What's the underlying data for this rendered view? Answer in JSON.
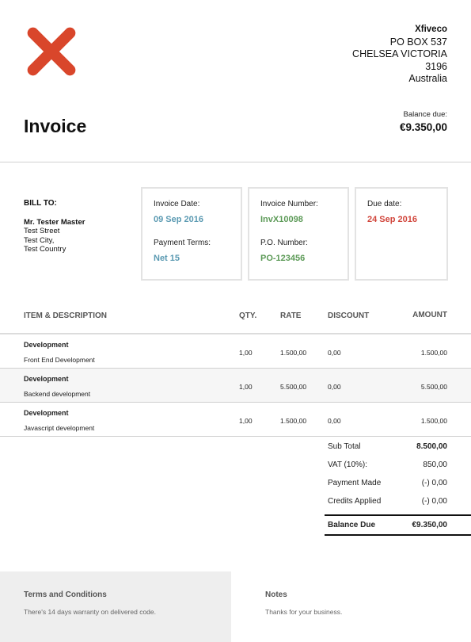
{
  "brand": {
    "logo_color": "#d9462b"
  },
  "company": {
    "name": "Xfiveco",
    "address_lines": [
      "PO BOX 537",
      "CHELSEA VICTORIA",
      "3196",
      "Australia"
    ]
  },
  "document": {
    "title": "Invoice",
    "balance_due_label": "Balance due:",
    "balance_due_amount": "€9.350,00"
  },
  "bill_to": {
    "label": "BILL TO:",
    "name": "Mr. Tester Master",
    "street": "Test Street",
    "city": "Test City,",
    "country": "Test Country"
  },
  "details": {
    "invoice_date_label": "Invoice Date:",
    "invoice_date": "09 Sep 2016",
    "payment_terms_label": "Payment Terms:",
    "payment_terms": "Net 15",
    "invoice_number_label": "Invoice Number:",
    "invoice_number": "InvX10098",
    "po_number_label": "P.O. Number:",
    "po_number": "PO-123456",
    "due_date_label": "Due date:",
    "due_date": "24 Sep 2016"
  },
  "table": {
    "headers": {
      "item": "ITEM & DESCRIPTION",
      "qty": "QTY.",
      "rate": "RATE",
      "discount": "DISCOUNT",
      "amount": "AMOUNT"
    },
    "rows": [
      {
        "item": "Development",
        "description": "Front End Development",
        "qty": "1,00",
        "rate": "1.500,00",
        "discount": "0,00",
        "amount": "1.500,00"
      },
      {
        "item": "Development",
        "description": "Backend development",
        "qty": "1,00",
        "rate": "5.500,00",
        "discount": "0,00",
        "amount": "5.500,00"
      },
      {
        "item": "Development",
        "description": "Javascript development",
        "qty": "1,00",
        "rate": "1.500,00",
        "discount": "0,00",
        "amount": "1.500,00"
      }
    ]
  },
  "totals": {
    "subtotal_label": "Sub Total",
    "subtotal": "8.500,00",
    "vat_label": "VAT (10%):",
    "vat": "850,00",
    "payment_made_label": "Payment Made",
    "payment_made": "(-) 0,00",
    "credits_applied_label": "Credits Applied",
    "credits_applied": "(-) 0,00",
    "balance_due_label": "Balance Due",
    "balance_due": "€9.350,00"
  },
  "footer": {
    "terms_title": "Terms and Conditions",
    "terms_text": "There's 14 days warranty on delivered code.",
    "notes_title": "Notes",
    "notes_text": "Thanks for your business."
  }
}
